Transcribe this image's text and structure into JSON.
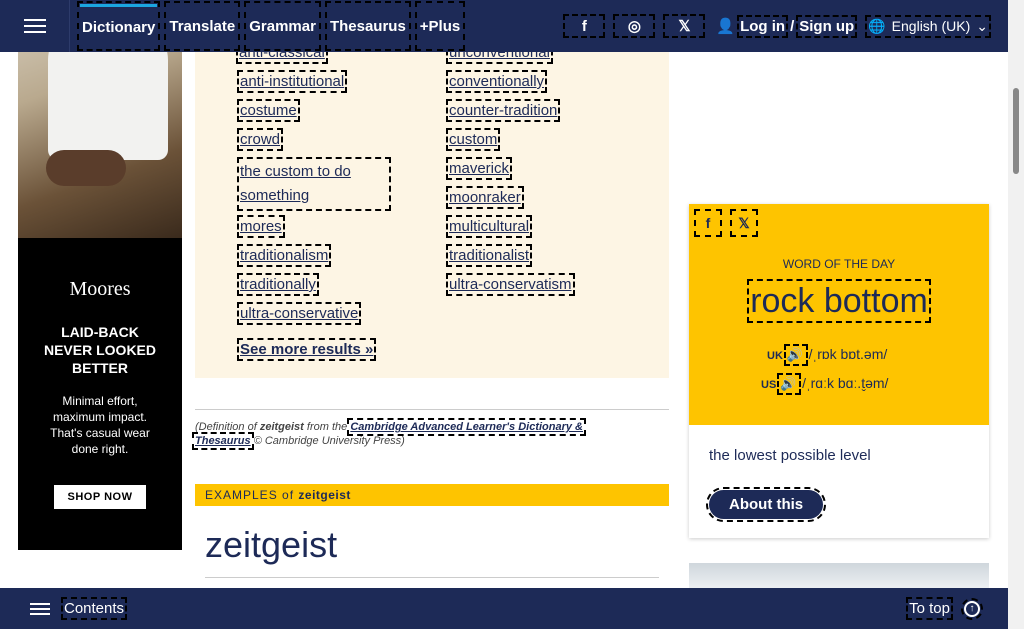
{
  "nav": {
    "items": [
      "Dictionary",
      "Translate",
      "Grammar",
      "Thesaurus",
      "+Plus"
    ],
    "login": "Log in",
    "separator": "/",
    "signup": "Sign up",
    "language": "English (UK)",
    "social_icons": [
      "facebook-icon",
      "instagram-icon",
      "x-icon"
    ]
  },
  "ad": {
    "brand": "Moores",
    "headline": "LAID-BACK NEVER LOOKED BETTER",
    "sub": "Minimal effort, maximum impact. That's casual wear done right.",
    "cta": "SHOP NOW"
  },
  "related": {
    "left": [
      "anti-institutional",
      "costume",
      "crowd",
      "the custom to do something",
      "mores",
      "traditionalism",
      "traditionally",
      "ultra-conservative"
    ],
    "right": [
      "unconventional",
      "conventionally",
      "counter-tradition",
      "custom",
      "maverick",
      "moonraker",
      "multicultural",
      "traditionalist",
      "ultra-conservatism"
    ],
    "top_left": "anti-classical",
    "more": "See more results »"
  },
  "definition_note": {
    "prefix": "Definition of",
    "word": "zeitgeist",
    "middle": "from the",
    "source": "Cambridge Advanced Learner's Dictionary & Thesaurus",
    "suffix": "© Cambridge University Press)"
  },
  "examples": {
    "label": "EXAMPLES",
    "of": "of",
    "word": "zeitgeist",
    "heading": "zeitgeist"
  },
  "wotd": {
    "label": "WORD OF THE DAY",
    "word": "rock bottom",
    "uk_label": "UK",
    "uk_pron": "/ˌrɒk bɒt.əm/",
    "us_label": "US",
    "us_pron": "/ˌrɑːk bɑː.t̬əm/",
    "definition": "the lowest possible level",
    "about": "About this"
  },
  "bottom": {
    "contents": "Contents",
    "to_top": "To top"
  }
}
